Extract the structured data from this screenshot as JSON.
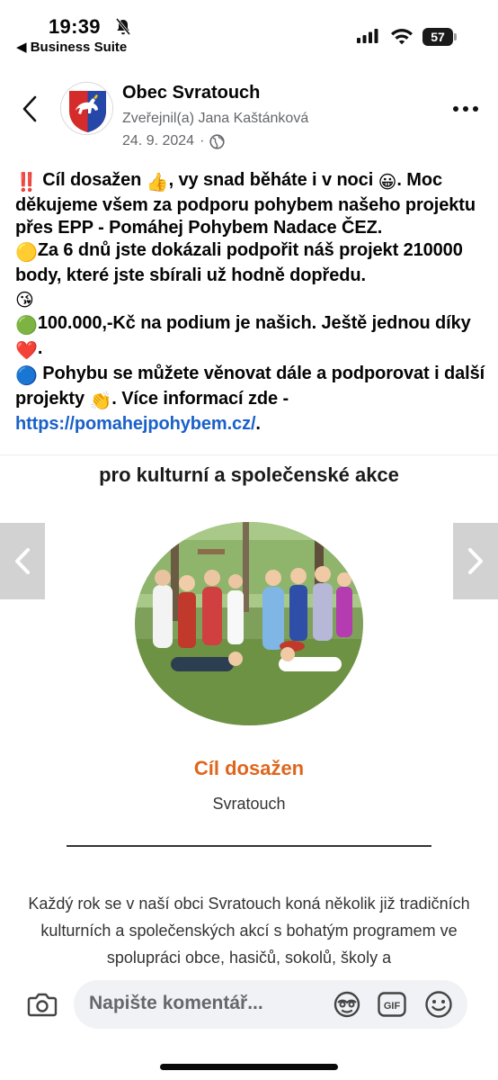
{
  "status_bar": {
    "time": "19:39",
    "back_app": "◀ Business Suite",
    "battery": "57"
  },
  "post": {
    "page_name": "Obec Svratouch",
    "author": "Zveřejnil(a) Jana Kaštánková",
    "date": "24. 9. 2024",
    "date_sep": "·",
    "lines": {
      "l1_a": "‼️",
      "l1_b": " Cíl dosažen ",
      "l1_c": "👍",
      "l1_d": ", vy snad běháte i v noci ",
      "l1_e": "😀",
      "l1_f": ". Moc děkujeme všem za podporu pohybem našeho projektu přes EPP - Pomáhej Pohybem Nadace ČEZ.",
      "l2_a": "🟡",
      "l2_b": "Za 6 dnů jste dokázali podpořit náš projekt 210000 body, které jste sbírali už hodně dopředu.",
      "l2_c": "😘",
      "l3_a": "🟢",
      "l3_b": "100.000,-Kč na podium je našich. Ještě jednou díky",
      "l3_c": "❤️",
      "l3_d": ".",
      "l4_a": "🔵",
      "l4_b": " Pohybu se můžete věnovat dále a podporovat i další projekty ",
      "l4_c": "👏",
      "l4_d": ". Více informací zde - ",
      "l4_link": "https://pomahejpohybem.cz/",
      "l4_end": "."
    }
  },
  "attachment": {
    "heading": "pro kulturní a společenské akce",
    "goal_title": "Cíl dosažen",
    "place": "Svratouch",
    "description": "Každý rok se v naší obci Svratouch koná několik již tradičních kulturních a společenských akcí s bohatým programem ve spolupráci obce, hasičů, sokolů, školy a"
  },
  "comment_bar": {
    "placeholder": "Napište komentář..."
  },
  "colors": {
    "link": "#1a60c9",
    "goal_title": "#e0651c",
    "secondary_text": "#65676b",
    "comment_field_bg": "#f0f2f5"
  },
  "icons": [
    "bell-off-icon",
    "signal-icon",
    "wifi-icon",
    "battery-icon",
    "back-chevron-icon",
    "coat-of-arms-icon",
    "globe-icon",
    "more-dots-icon",
    "chevron-left-icon",
    "chevron-right-icon",
    "camera-icon",
    "avatar-sticker-icon",
    "gif-icon",
    "smiley-icon"
  ]
}
